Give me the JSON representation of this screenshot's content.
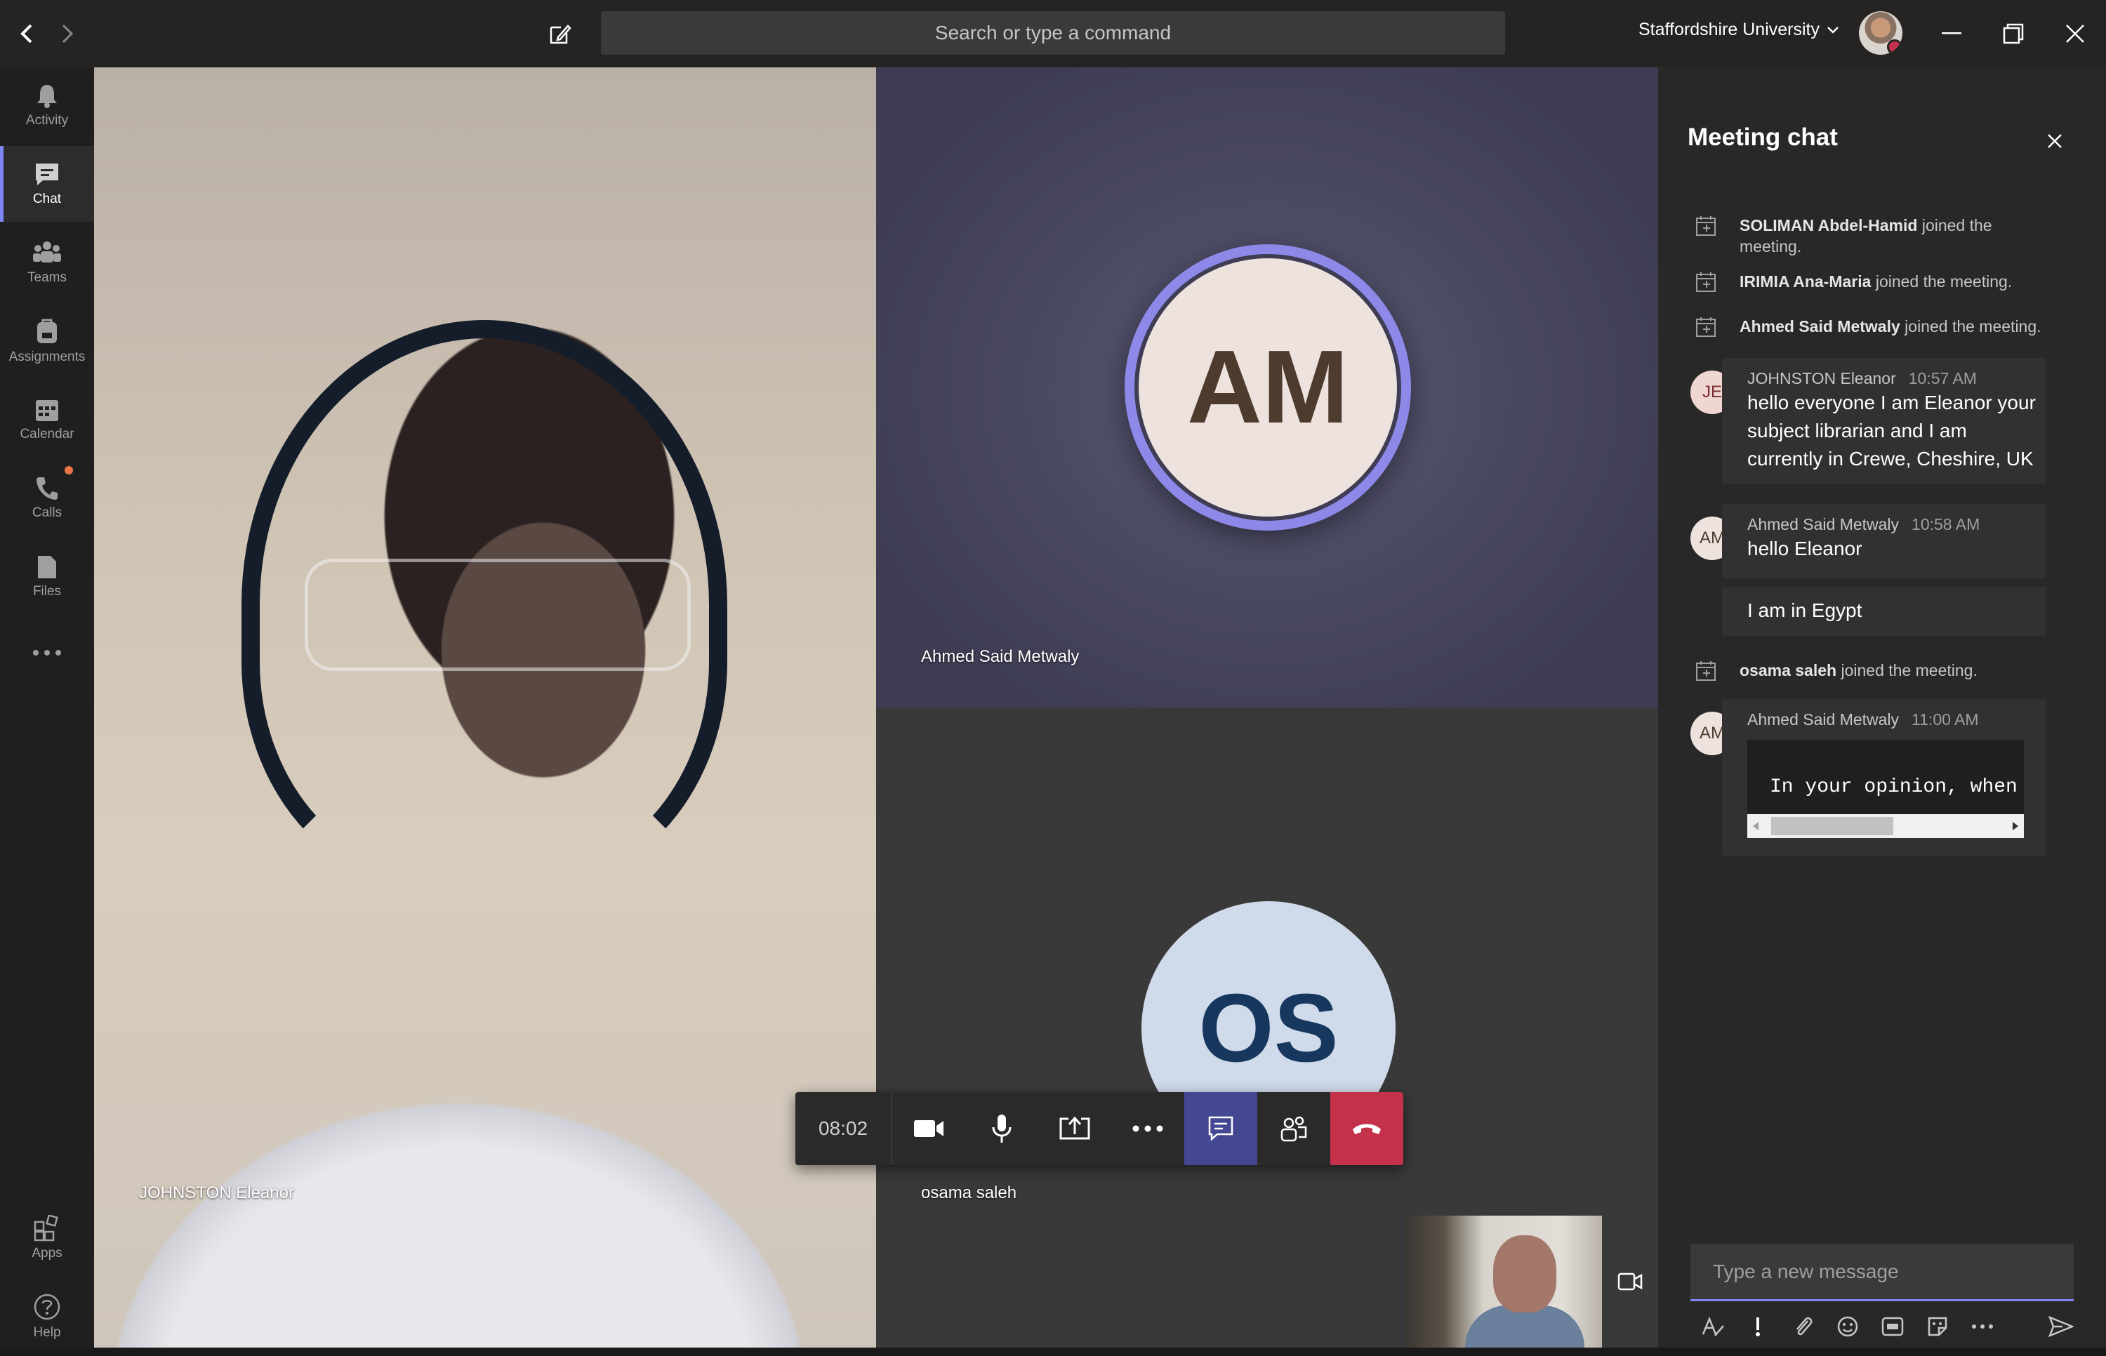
{
  "titlebar": {
    "search_placeholder": "Search or type a command",
    "organization": "Staffordshire University"
  },
  "rail": {
    "items": [
      {
        "label": "Activity",
        "icon": "bell-icon"
      },
      {
        "label": "Chat",
        "icon": "chat-icon",
        "active": true
      },
      {
        "label": "Teams",
        "icon": "teams-icon"
      },
      {
        "label": "Assignments",
        "icon": "backpack-icon"
      },
      {
        "label": "Calendar",
        "icon": "calendar-icon"
      },
      {
        "label": "Calls",
        "icon": "phone-icon"
      },
      {
        "label": "Files",
        "icon": "file-icon"
      }
    ],
    "apps_label": "Apps",
    "help_label": "Help"
  },
  "stage": {
    "main_name": "JOHNSTON Eleanor",
    "tile_ahmed": {
      "name": "Ahmed Said Metwaly",
      "initials": "AM"
    },
    "tile_osama": {
      "name": "osama saleh",
      "initials": "OS"
    },
    "timer": "08:02"
  },
  "chat": {
    "title": "Meeting chat",
    "system": [
      {
        "name": "SOLIMAN Abdel-Hamid",
        "text": " joined the meeting."
      },
      {
        "name": "IRIMIA Ana-Maria",
        "text": " joined the meeting."
      },
      {
        "name": "Ahmed Said Metwaly",
        "text": " joined the meeting."
      },
      {
        "name": "osama saleh",
        "text": " joined the meeting."
      }
    ],
    "messages": [
      {
        "initials": "JE",
        "sender": "JOHNSTON Eleanor",
        "time": "10:57 AM",
        "text": "hello everyone I am Eleanor your subject librarian and I am currently in Crewe, Cheshire, UK"
      },
      {
        "initials": "AM",
        "sender": "Ahmed Said Metwaly",
        "time": "10:58 AM",
        "text": "hello Eleanor"
      },
      {
        "text": "I am in  Egypt"
      },
      {
        "initials": "AM",
        "sender": "Ahmed Said Metwaly",
        "time": "11:00 AM",
        "code": "In your opinion, when th"
      }
    ],
    "compose_placeholder": "Type a new message"
  },
  "colors": {
    "accent": "#7f85f5",
    "hangup": "#c4314b",
    "chat_active": "#444791"
  }
}
